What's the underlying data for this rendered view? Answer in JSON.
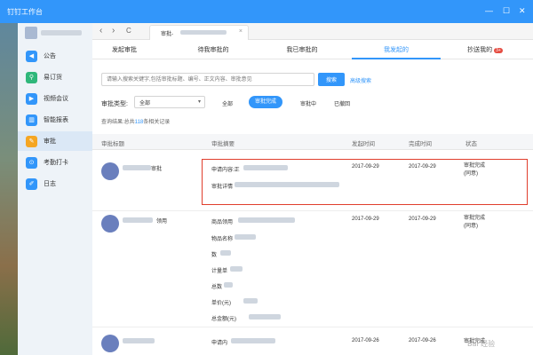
{
  "window": {
    "app_title": "钉钉工作台"
  },
  "browser": {
    "tab_title": "审批-",
    "close_glyph": "×",
    "back": "‹",
    "forward": "›",
    "refresh": "C"
  },
  "sidebar": {
    "items": [
      {
        "label": "公告",
        "color": "#3296fa",
        "icon": "megaphone-icon",
        "glyph": "◀"
      },
      {
        "label": "易订货",
        "color": "#2fb77a",
        "icon": "shop-icon",
        "glyph": "⚲"
      },
      {
        "label": "视频会议",
        "color": "#3296fa",
        "icon": "video-icon",
        "glyph": "▶"
      },
      {
        "label": "智能报表",
        "color": "#3296fa",
        "icon": "chart-icon",
        "glyph": "▥"
      },
      {
        "label": "审批",
        "color": "#f5a623",
        "icon": "approval-icon",
        "glyph": "✎"
      },
      {
        "label": "考勤打卡",
        "color": "#3296fa",
        "icon": "location-icon",
        "glyph": "⊙"
      },
      {
        "label": "日志",
        "color": "#3296fa",
        "icon": "log-icon",
        "glyph": "✐"
      }
    ]
  },
  "topmenu": {
    "tabs": [
      "发起审批",
      "待我审批的",
      "我已审批的",
      "我发起的",
      "抄送我的"
    ],
    "badge": "3+"
  },
  "search": {
    "placeholder": "请输入搜索关键字,包括审批标题、编号、正文内容、审批意见",
    "button": "搜索",
    "advanced": "高级搜索"
  },
  "filter": {
    "type_label": "审批类型:",
    "type_value": "全部",
    "caret": "▾",
    "statuses": [
      "全部",
      "审批完成",
      "审批中",
      "已撤回"
    ]
  },
  "result": {
    "prefix": "查询结果:总共",
    "count": "118",
    "suffix": "条相关记录"
  },
  "table": {
    "headers": [
      "审批标题",
      "审批摘要",
      "发起时间",
      "完成时间",
      "状态"
    ],
    "rows": [
      {
        "title_suffix": "审批",
        "summary": [
          "申请内容:正",
          "审批详情"
        ],
        "start": "2017-09-29",
        "end": "2017-09-29",
        "status": [
          "审批完成",
          "(同意)"
        ]
      },
      {
        "title_suffix": "领用",
        "summary": [
          "商品领用",
          "物品名称",
          "数",
          "计量单",
          "总数",
          "单价(元)",
          "总金额(元)"
        ],
        "start": "2017-09-29",
        "end": "2017-09-29",
        "status": [
          "审批完成",
          "(同意)"
        ]
      },
      {
        "title_suffix": "",
        "summary": [
          "申请内"
        ],
        "start": "2017-09-26",
        "end": "2017-09-26",
        "status": [
          "审批完成"
        ]
      }
    ]
  },
  "watermark": "Bai 经验"
}
